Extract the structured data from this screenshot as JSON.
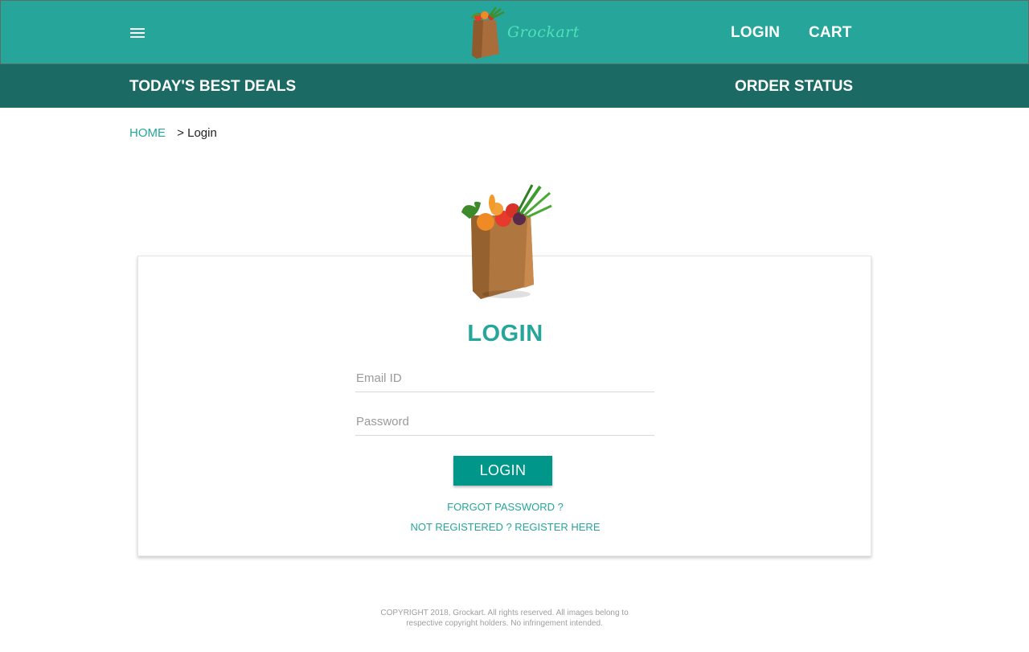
{
  "header": {
    "menu_icon": "hamburger-menu-icon",
    "brand_name": "Grockart",
    "login_label": "LOGIN",
    "cart_label": "CART"
  },
  "subnav": {
    "deals_label": "TODAY'S BEST DEALS",
    "order_status_label": "ORDER STATUS"
  },
  "breadcrumb": {
    "home_label": "HOME",
    "separator": ">",
    "current_label": "Login"
  },
  "login_card": {
    "title": "LOGIN",
    "email_placeholder": "Email ID",
    "email_value": "",
    "password_placeholder": "Password",
    "password_value": "",
    "submit_label": "LOGIN",
    "forgot_label": "FORGOT PASSWORD ?",
    "register_label": "NOT REGISTERED ? REGISTER HERE",
    "image_icon": "grocery-bag-icon"
  },
  "footer": {
    "copyright_line1": "COPYRIGHT 2018, Grockart. All rights reserved. All images belong to",
    "copyright_line2": "respective copyright holders. No infringement intended."
  },
  "colors": {
    "primary": "#26a69a",
    "primary_dark": "#1b6b64",
    "button": "#00968a",
    "brand_text": "#4ee0b8"
  }
}
